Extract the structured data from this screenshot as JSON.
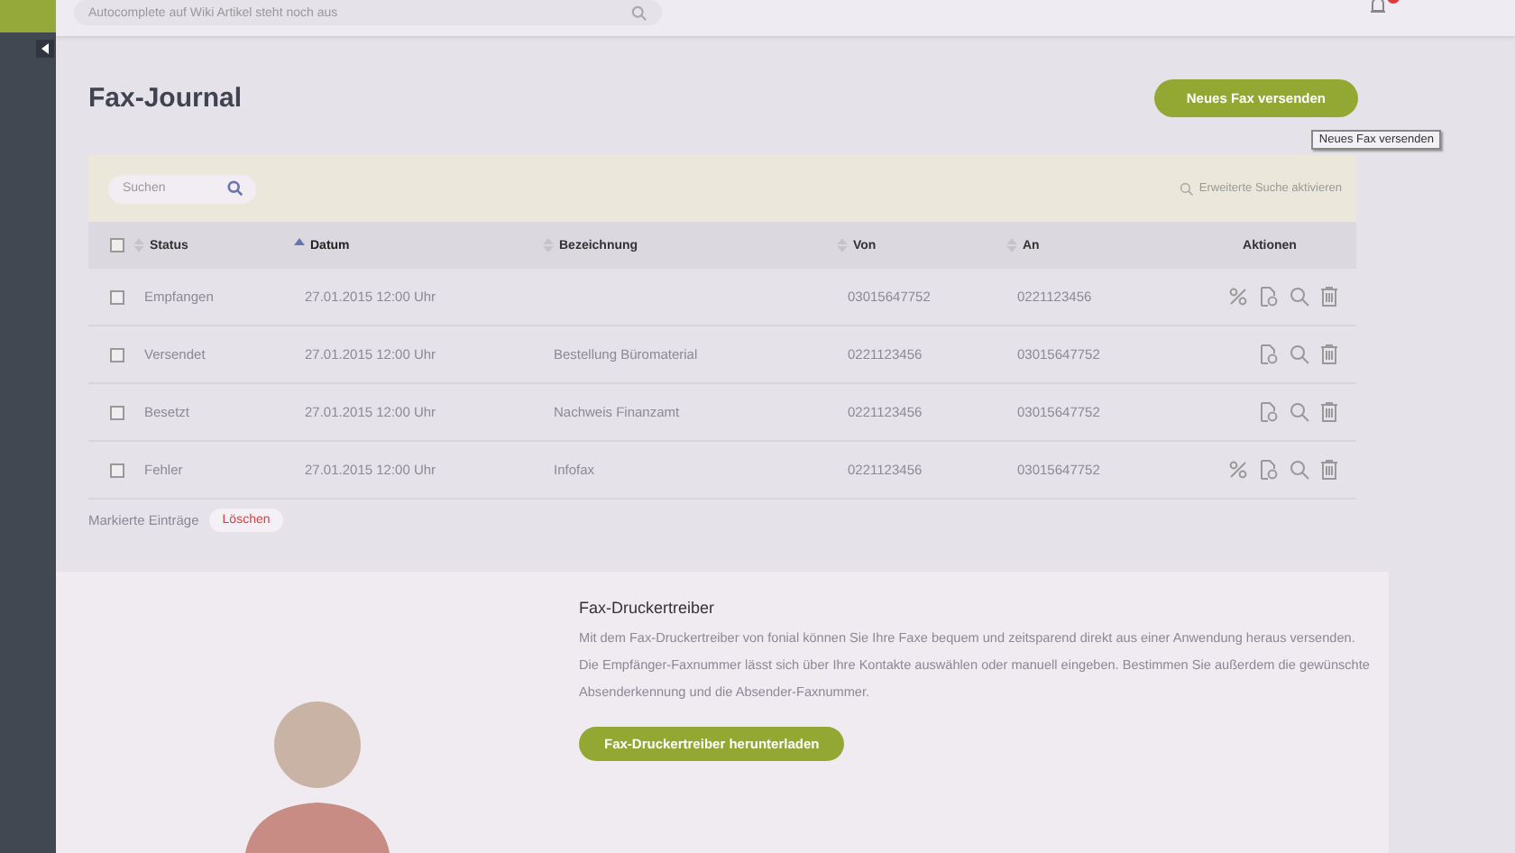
{
  "topbar": {
    "search": {
      "placeholder": "Autocomplete auf Wiki Artikel steht noch aus"
    },
    "notification_badge": true
  },
  "page": {
    "title": "Fax-Journal",
    "new_fax_button": "Neues Fax versenden",
    "tooltip": "Neues Fax versenden"
  },
  "table": {
    "search": {
      "placeholder": "Suchen"
    },
    "advanced_search": "Erweiterte Suche aktivieren",
    "select_all": {
      "checked": false
    },
    "columns": [
      {
        "label": "Status",
        "sortable": true,
        "sorted": false
      },
      {
        "label": "Datum",
        "sortable": true,
        "sorted": true
      },
      {
        "label": "Bezeichnung",
        "sortable": true,
        "sorted": false
      },
      {
        "label": "Von",
        "sortable": true,
        "sorted": false
      },
      {
        "label": "An",
        "sortable": true,
        "sorted": false
      },
      {
        "label": "Aktionen",
        "sortable": false,
        "sorted": false
      }
    ],
    "rows": [
      {
        "checked": false,
        "cells": [
          "Empfangen",
          "27.01.2015 12:00 Uhr",
          "",
          "03015647752",
          "0221123456"
        ],
        "actions": [
          {
            "kind": "percent"
          },
          {
            "kind": "document"
          },
          {
            "kind": "search"
          },
          {
            "kind": "trash"
          }
        ]
      },
      {
        "checked": false,
        "cells": [
          "Versendet",
          "27.01.2015 12:00 Uhr",
          "Bestellung Büromaterial",
          "0221123456",
          "03015647752"
        ],
        "actions": [
          {
            "kind": "document"
          },
          {
            "kind": "search"
          },
          {
            "kind": "trash"
          }
        ]
      },
      {
        "checked": false,
        "cells": [
          "Besetzt",
          "27.01.2015 12:00 Uhr",
          "Nachweis Finanzamt",
          "0221123456",
          "03015647752"
        ],
        "actions": [
          {
            "kind": "document"
          },
          {
            "kind": "search"
          },
          {
            "kind": "trash"
          }
        ]
      },
      {
        "checked": false,
        "cells": [
          "Fehler",
          "27.01.2015 12:00 Uhr",
          "Infofax",
          "0221123456",
          "03015647752"
        ],
        "actions": [
          {
            "kind": "percent"
          },
          {
            "kind": "document"
          },
          {
            "kind": "search"
          },
          {
            "kind": "trash"
          }
        ]
      }
    ],
    "bulk_label": "Markierte Einträge",
    "delete_button": "Löschen"
  },
  "promo": {
    "title": "Fax-Druckertreiber",
    "text": "Mit dem Fax-Druckertreiber von fonial können Sie Ihre Faxe bequem und zeitsparend direkt aus einer Anwendung heraus versenden. Die Empfänger-Faxnummer lässt sich über Ihre Kontakte auswählen oder manuell eingeben. Bestimmen Sie außerdem die gewünschte Absenderkennung und die Absender-Faxnummer.",
    "button": "Fax-Druckertreiber herunterladen"
  }
}
